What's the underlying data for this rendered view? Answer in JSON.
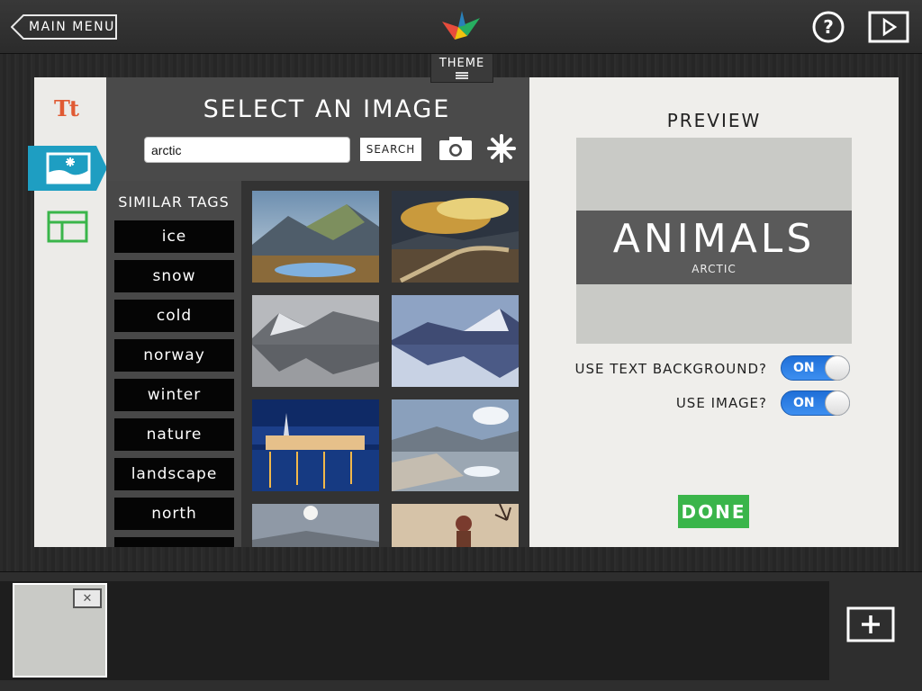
{
  "header": {
    "main_menu_label": "MAIN MENU",
    "theme_label": "THEME"
  },
  "tools": {
    "text_tool_label": "Tt"
  },
  "select_image": {
    "title": "SELECT AN IMAGE",
    "search_value": "arctic",
    "search_button_label": "SEARCH",
    "similar_tags_label": "SIMILAR TAGS",
    "tags": [
      "ice",
      "snow",
      "cold",
      "norway",
      "winter",
      "nature",
      "landscape",
      "north"
    ]
  },
  "preview": {
    "label": "PREVIEW",
    "title_text": "ANIMALS",
    "subtitle_text": "ARCTIC",
    "use_text_background_label": "USE TEXT BACKGROUND?",
    "use_text_background_value": "ON",
    "use_image_label": "USE IMAGE?",
    "use_image_value": "ON",
    "done_label": "DONE"
  },
  "colors": {
    "accent_blue": "#1e9ec2",
    "done_green": "#3ab54a",
    "text_tool_orange": "#e05a33",
    "layout_green": "#3ab54a"
  }
}
